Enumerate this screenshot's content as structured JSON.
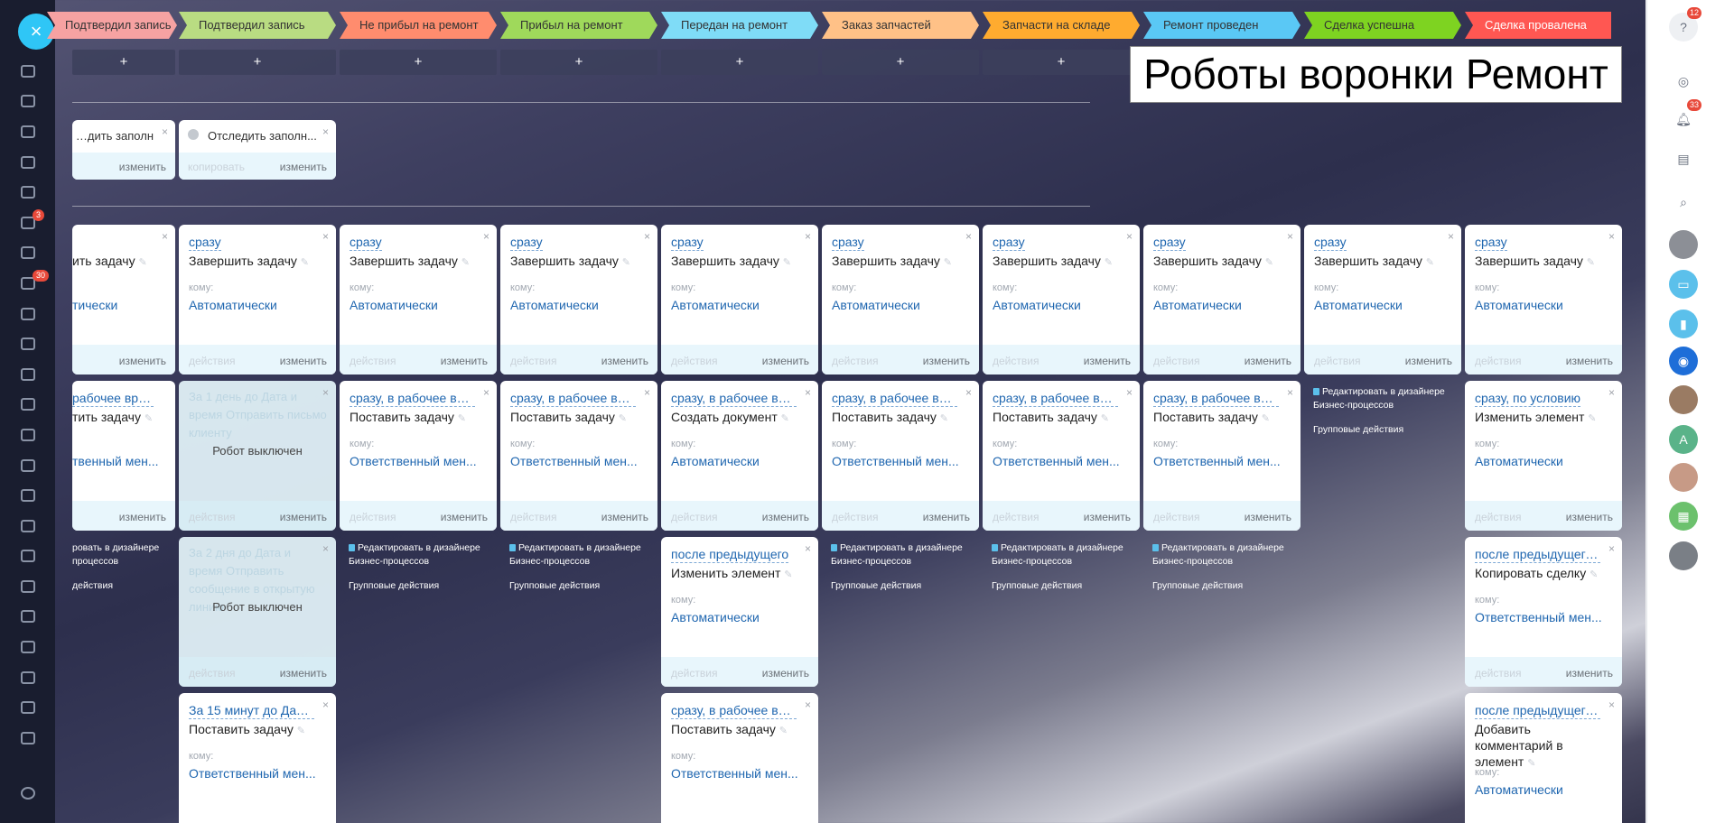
{
  "title_overlay": "Роботы воронки Ремонт",
  "stages": [
    {
      "label": "Подтвердил запись",
      "color": "#f6a2a2"
    },
    {
      "label": "Подтвердил запись",
      "color": "#b9dc82"
    },
    {
      "label": "Не прибыл на ремонт",
      "color": "#ff8c6e"
    },
    {
      "label": "Прибыл на ремонт",
      "color": "#9fd95b"
    },
    {
      "label": "Передан на ремонт",
      "color": "#7fdcf7"
    },
    {
      "label": "Заказ запчастей",
      "color": "#ffc187"
    },
    {
      "label": "Запчасти на складе",
      "color": "#ffab2f"
    },
    {
      "label": "Ремонт проведен",
      "color": "#5ac8f5"
    },
    {
      "label": "Сделка успешна",
      "color": "#7ed321"
    },
    {
      "label": "Сделка провалена",
      "color": "#ff5752"
    }
  ],
  "plus": "+",
  "common": {
    "to_label": "кому:",
    "footer_left": "действия",
    "footer_right": "изменить",
    "copy": "копировать",
    "robot_off": "Робот выключен",
    "bp_line1": "Редактировать в дизайнере",
    "bp_line2": "Бизнес-процессов",
    "bp_group": "Групповые действия",
    "bp_cut1": "ровать в дизайнере",
    "bp_cut2": "процессов",
    "bp_cut3": "действия",
    "pen": "✎",
    "close": "×"
  },
  "client_cards": [
    {
      "text": "Отследить заполн..."
    },
    {
      "text": "Отследить заполн..."
    }
  ],
  "row1": [
    {
      "trigger": "",
      "action": "Завершить задачу",
      "to": "Автоматически",
      "partial": "ить задачу",
      "partial_to": "тически"
    },
    {
      "trigger": "сразу",
      "action": "Завершить задачу",
      "to": "Автоматически"
    },
    {
      "trigger": "сразу",
      "action": "Завершить задачу",
      "to": "Автоматически"
    },
    {
      "trigger": "сразу",
      "action": "Завершить задачу",
      "to": "Автоматически"
    },
    {
      "trigger": "сразу",
      "action": "Завершить задачу",
      "to": "Автоматически"
    },
    {
      "trigger": "сразу",
      "action": "Завершить задачу",
      "to": "Автоматически"
    },
    {
      "trigger": "сразу",
      "action": "Завершить задачу",
      "to": "Автоматически"
    },
    {
      "trigger": "сразу",
      "action": "Завершить задачу",
      "to": "Автоматически"
    },
    {
      "trigger": "сразу",
      "action": "Завершить задачу",
      "to": "Автоматически"
    },
    {
      "trigger": "сразу",
      "action": "Завершить задачу",
      "to": "Автоматически"
    }
  ],
  "row2": [
    {
      "trigger": "рабочее время",
      "action": "тить задачу",
      "to": "твенный мен..."
    },
    {
      "ghost": "За 1 день до Дата и время Отправить письмо клиенту"
    },
    {
      "trigger": "сразу, в рабочее время",
      "action": "Поставить задачу",
      "to": "Ответственный мен..."
    },
    {
      "trigger": "сразу, в рабочее время",
      "action": "Поставить задачу",
      "to": "Ответственный мен..."
    },
    {
      "trigger": "сразу, в рабочее время",
      "action": "Создать документ",
      "to": "Автоматически"
    },
    {
      "trigger": "сразу, в рабочее врем...",
      "action": "Поставить задачу",
      "to": "Ответственный мен..."
    },
    {
      "trigger": "сразу, в рабочее врем...",
      "action": "Поставить задачу",
      "to": "Ответственный мен..."
    },
    {
      "trigger": "сразу, в рабочее время",
      "action": "Поставить задачу",
      "to": "Ответственный мен..."
    },
    {
      "trigger": "сразу, по условию",
      "action": "Изменить элемент",
      "to": "Автоматически"
    }
  ],
  "row3": [
    {
      "ghost": "За 2 дня до Дата и время Отправить сообщение в открытую линию"
    },
    {
      "trigger": "после предыдущего",
      "action": "Изменить элемент",
      "to": "Автоматически"
    },
    {
      "trigger": "после предыдущего, п...",
      "action": "Копировать сделку",
      "to": "Ответственный мен..."
    }
  ],
  "row4": [
    {
      "trigger": "За 15 минут до Дата и...",
      "action": "Поставить задачу",
      "to": "Ответственный мен..."
    },
    {
      "trigger": "сразу, в рабочее врем...",
      "action": "Поставить задачу",
      "to": "Ответственный мен..."
    },
    {
      "trigger": "после предыдущего, п...",
      "action": "Добавить комментарий в элемент",
      "to": "Автоматически"
    }
  ],
  "leftbar": {
    "badge_tasks": "3",
    "badge_feed": "30"
  },
  "rightbar": {
    "help_count": "12",
    "notif_count": "33",
    "avatar_letter": "A"
  }
}
